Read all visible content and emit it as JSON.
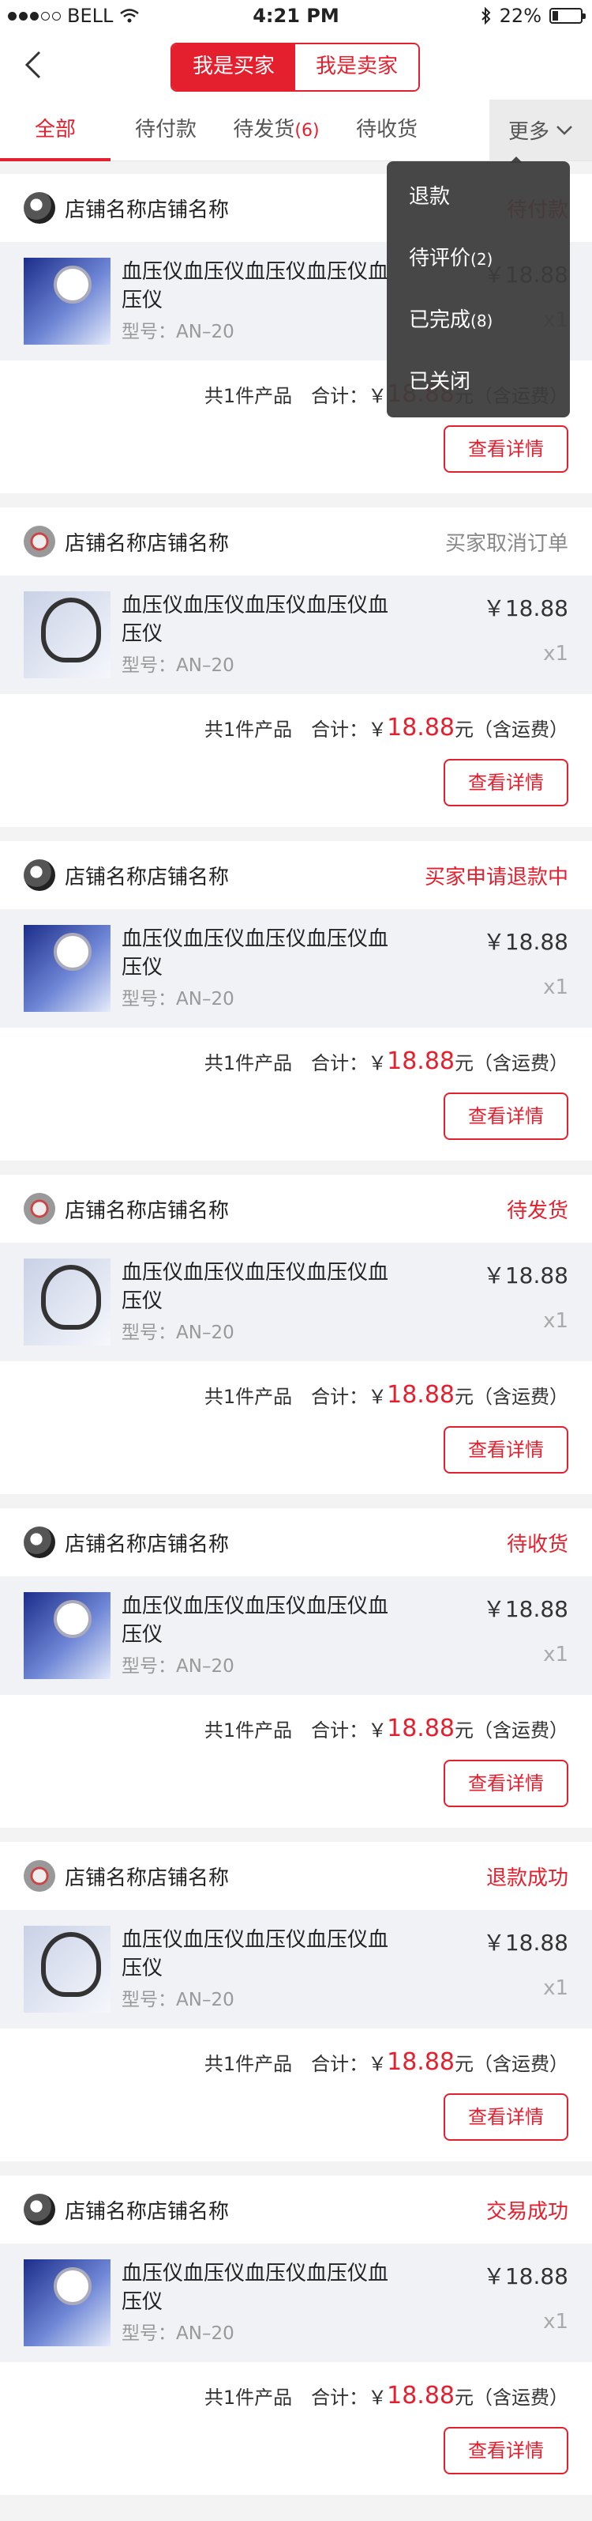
{
  "status_bar": {
    "carrier": "BELL",
    "time": "4:21 PM",
    "battery": "22%",
    "battery_level": 0.22
  },
  "header": {
    "segment": [
      "我是买家",
      "我是卖家"
    ]
  },
  "tabs": [
    {
      "label": "全部",
      "count": ""
    },
    {
      "label": "待付款",
      "count": ""
    },
    {
      "label": "待发货",
      "count": "(6)"
    },
    {
      "label": "待收货",
      "count": ""
    }
  ],
  "more_label": "更多",
  "dropdown": [
    {
      "label": "退款",
      "count": ""
    },
    {
      "label": "待评价",
      "count": "(2)"
    },
    {
      "label": "已完成",
      "count": "(8)"
    },
    {
      "label": "已关闭",
      "count": ""
    }
  ],
  "orders": [
    {
      "shop": "店铺名称店铺名称",
      "status": "待付款",
      "title": "血压仪血压仪血压仪血压仪血压仪",
      "model": "型号：AN–20",
      "price": "￥18.88",
      "qty": "x1",
      "summary": "共1件产品",
      "total_label": "合计：￥",
      "total": "18.88",
      "total_suffix": "元（含运费）",
      "button": "查看详情"
    },
    {
      "shop": "店铺名称店铺名称",
      "status": "买家取消订单",
      "title": "血压仪血压仪血压仪血压仪血压仪",
      "model": "型号：AN–20",
      "price": "￥18.88",
      "qty": "x1",
      "summary": "共1件产品",
      "total_label": "合计：￥",
      "total": "18.88",
      "total_suffix": "元（含运费）",
      "button": "查看详情"
    },
    {
      "shop": "店铺名称店铺名称",
      "status": "买家申请退款中",
      "title": "血压仪血压仪血压仪血压仪血压仪",
      "model": "型号：AN–20",
      "price": "￥18.88",
      "qty": "x1",
      "summary": "共1件产品",
      "total_label": "合计：￥",
      "total": "18.88",
      "total_suffix": "元（含运费）",
      "button": "查看详情"
    },
    {
      "shop": "店铺名称店铺名称",
      "status": "待发货",
      "title": "血压仪血压仪血压仪血压仪血压仪",
      "model": "型号：AN–20",
      "price": "￥18.88",
      "qty": "x1",
      "summary": "共1件产品",
      "total_label": "合计：￥",
      "total": "18.88",
      "total_suffix": "元（含运费）",
      "button": "查看详情"
    },
    {
      "shop": "店铺名称店铺名称",
      "status": "待收货",
      "title": "血压仪血压仪血压仪血压仪血压仪",
      "model": "型号：AN–20",
      "price": "￥18.88",
      "qty": "x1",
      "summary": "共1件产品",
      "total_label": "合计：￥",
      "total": "18.88",
      "total_suffix": "元（含运费）",
      "button": "查看详情"
    },
    {
      "shop": "店铺名称店铺名称",
      "status": "退款成功",
      "title": "血压仪血压仪血压仪血压仪血压仪",
      "model": "型号：AN–20",
      "price": "￥18.88",
      "qty": "x1",
      "summary": "共1件产品",
      "total_label": "合计：￥",
      "total": "18.88",
      "total_suffix": "元（含运费）",
      "button": "查看详情"
    },
    {
      "shop": "店铺名称店铺名称",
      "status": "交易成功",
      "title": "血压仪血压仪血压仪血压仪血压仪",
      "model": "型号：AN–20",
      "price": "￥18.88",
      "qty": "x1",
      "summary": "共1件产品",
      "total_label": "合计：￥",
      "total": "18.88",
      "total_suffix": "元（含运费）",
      "button": "查看详情"
    }
  ],
  "colors": {
    "accent": "#e4202e",
    "status_gray": "#888888"
  }
}
